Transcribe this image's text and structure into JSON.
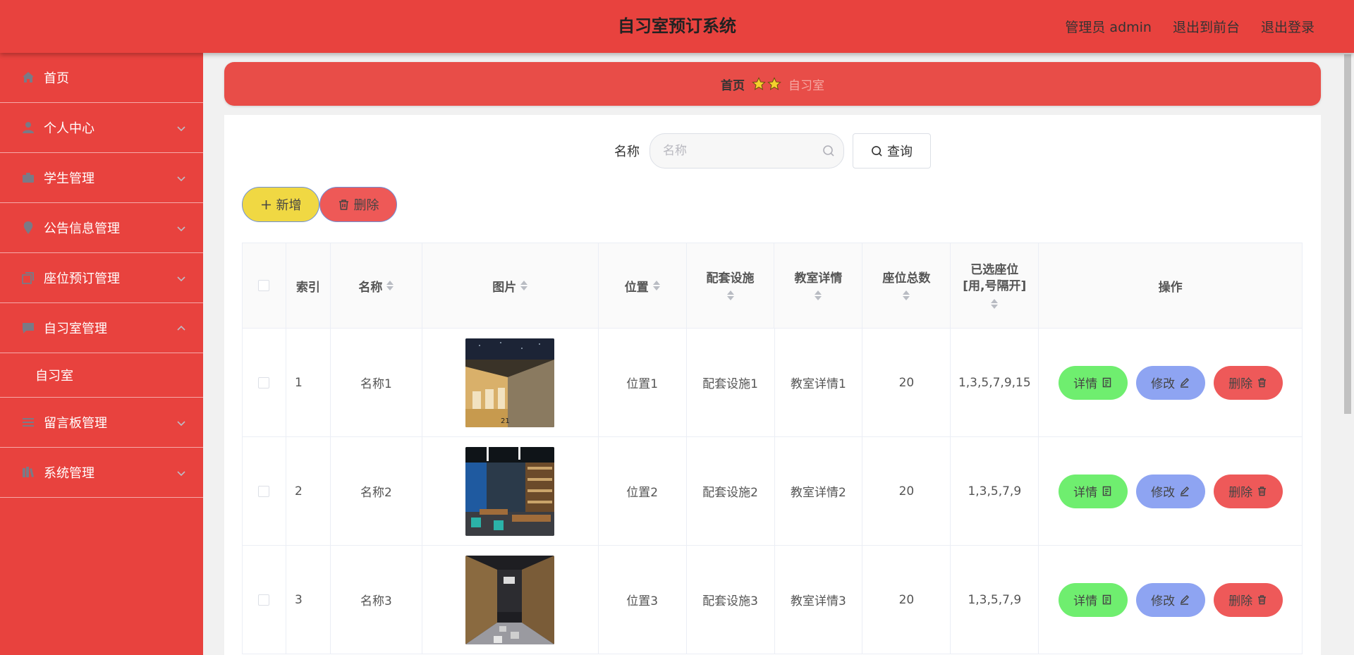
{
  "header": {
    "title": "自习室预订系统",
    "user_label": "管理员 admin",
    "front_link": "退出到前台",
    "logout_link": "退出登录"
  },
  "sidebar": {
    "items": [
      {
        "label": "首页",
        "icon": "home-icon"
      },
      {
        "label": "个人中心",
        "icon": "user-icon"
      },
      {
        "label": "学生管理",
        "icon": "briefcase-icon"
      },
      {
        "label": "公告信息管理",
        "icon": "location-icon"
      },
      {
        "label": "座位预订管理",
        "icon": "copy-icon"
      },
      {
        "label": "自习室管理",
        "icon": "message-icon"
      },
      {
        "label": "留言板管理",
        "icon": "list-icon"
      },
      {
        "label": "系统管理",
        "icon": "library-icon"
      }
    ],
    "submenu": {
      "label": "自习室"
    }
  },
  "breadcrumb": {
    "home": "首页",
    "current": "自习室"
  },
  "search": {
    "label": "名称",
    "placeholder": "名称",
    "button": "查询"
  },
  "actions": {
    "add": "新增",
    "delete": "删除"
  },
  "table": {
    "headers": {
      "index": "索引",
      "name": "名称",
      "image": "图片",
      "location": "位置",
      "facilities": "配套设施",
      "details": "教室详情",
      "seat_total": "座位总数",
      "selected_seats_l1": "已选座位",
      "selected_seats_l2": "[用,号隔开]",
      "ops": "操作"
    },
    "rows": [
      {
        "index": "1",
        "name": "名称1",
        "location": "位置1",
        "facilities": "配套设施1",
        "details": "教室详情1",
        "seat_total": "20",
        "selected": "1,3,5,7,9,15"
      },
      {
        "index": "2",
        "name": "名称2",
        "location": "位置2",
        "facilities": "配套设施2",
        "details": "教室详情2",
        "seat_total": "20",
        "selected": "1,3,5,7,9"
      },
      {
        "index": "3",
        "name": "名称3",
        "location": "位置3",
        "facilities": "配套设施3",
        "details": "教室详情3",
        "seat_total": "20",
        "selected": "1,3,5,7,9"
      }
    ],
    "op_labels": {
      "detail": "详情",
      "edit": "修改",
      "delete": "删除"
    }
  }
}
